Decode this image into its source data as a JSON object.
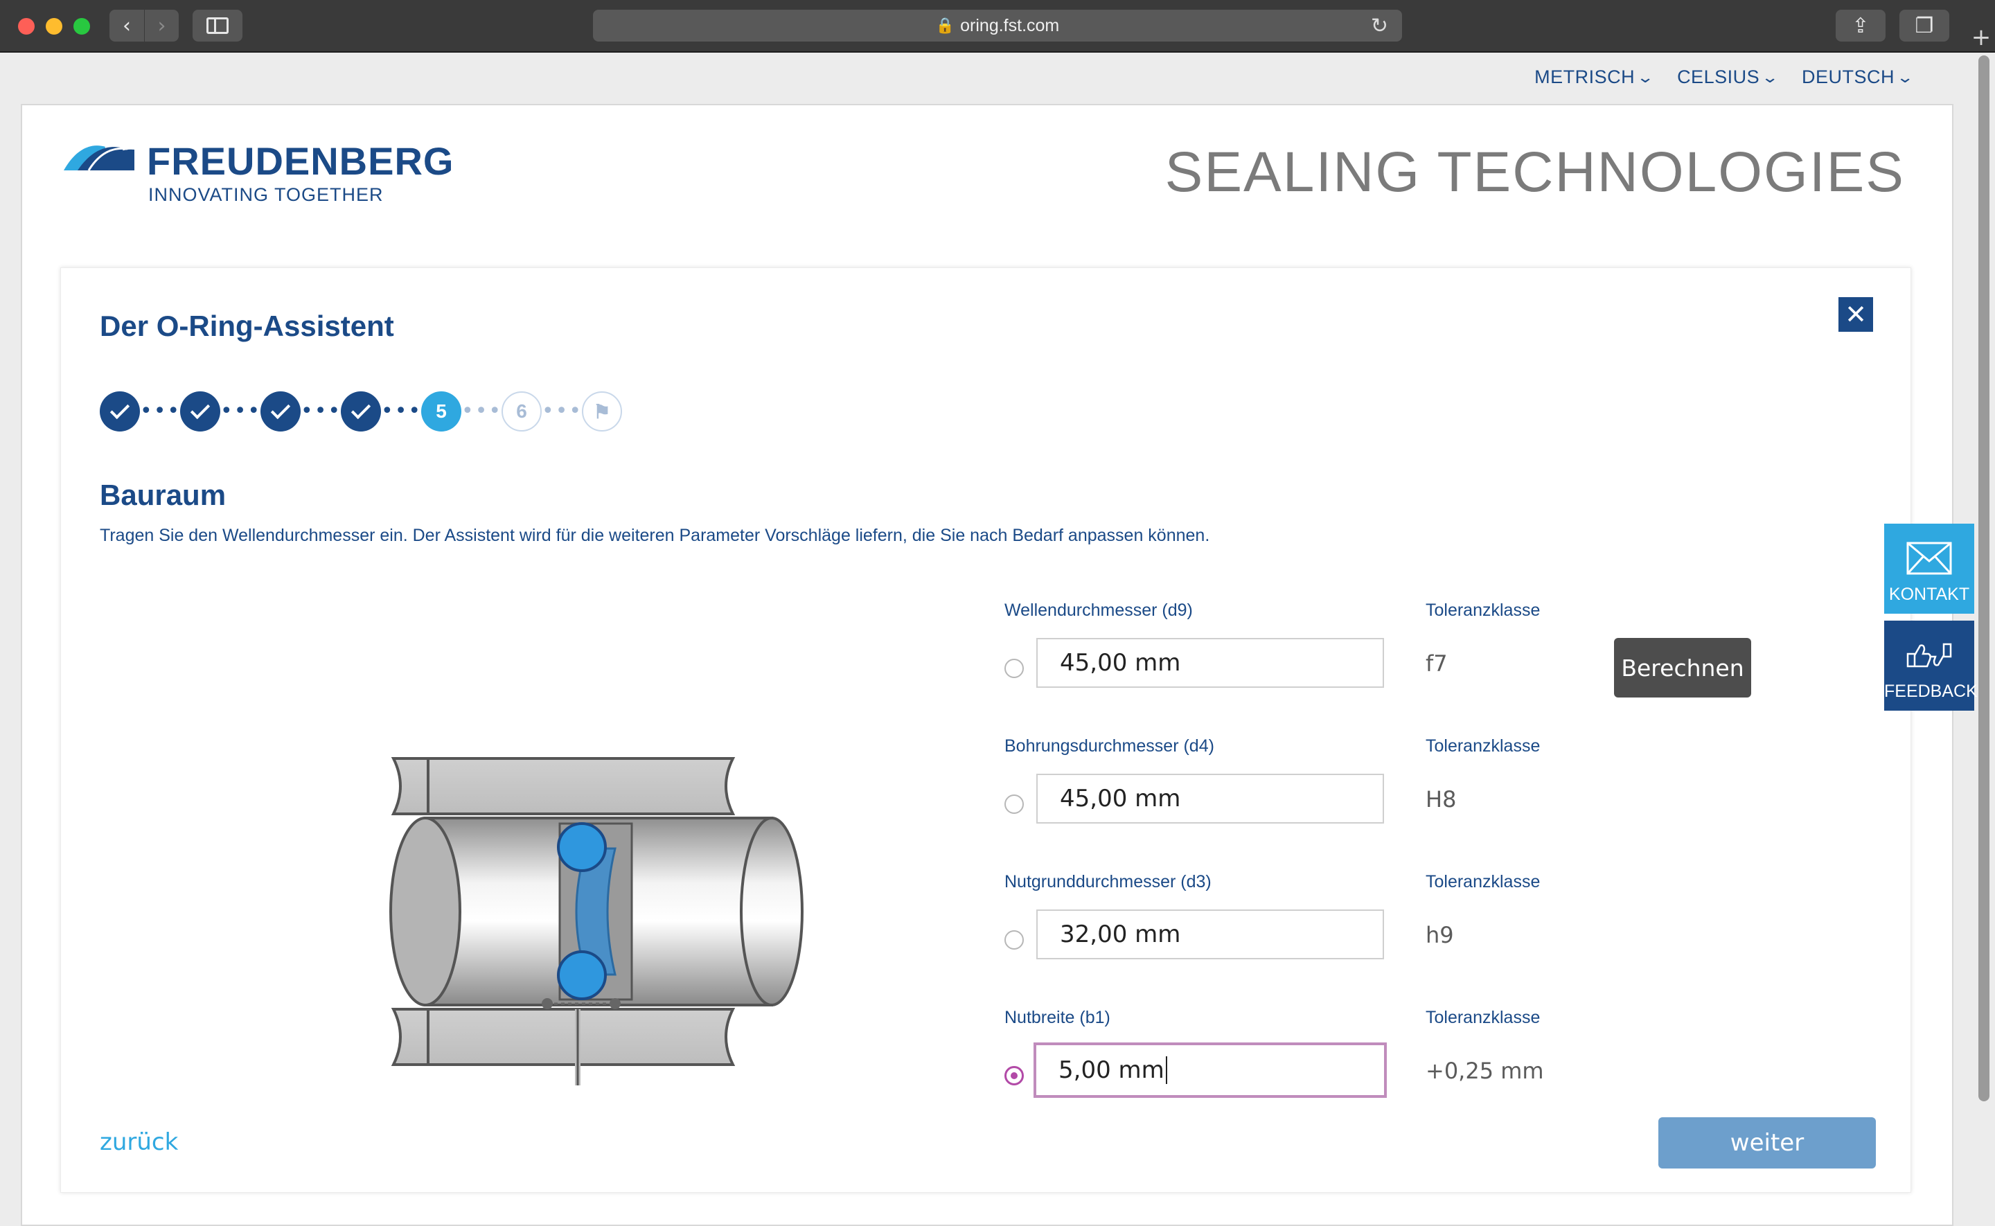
{
  "browser": {
    "url": "oring.fst.com",
    "lock_glyph": "🔒",
    "back_glyph": "‹",
    "forward_glyph": "›",
    "reload_glyph": "↻",
    "share_glyph": "⇪",
    "tabs_glyph": "❐",
    "newtab_glyph": "+"
  },
  "units": {
    "measurement": "METRISCH",
    "temperature": "CELSIUS",
    "language": "DEUTSCH",
    "chevron_glyph": "⌄"
  },
  "brand": {
    "name": "FREUDENBERG",
    "tagline": "INNOVATING TOGETHER",
    "division": "SEALING TECHNOLOGIES",
    "wave_color_light": "#2fa8e0",
    "wave_color_dark": "#1b4a87"
  },
  "assistant": {
    "title": "Der O-Ring-Assistent",
    "close_glyph": "✕",
    "steps": [
      {
        "label": "",
        "status": "done"
      },
      {
        "label": "",
        "status": "done"
      },
      {
        "label": "",
        "status": "done"
      },
      {
        "label": "",
        "status": "done"
      },
      {
        "label": "5",
        "status": "active"
      },
      {
        "label": "6",
        "status": "todo"
      },
      {
        "label": "⚑",
        "status": "todo"
      }
    ],
    "dots_glyph": "•••",
    "section_title": "Bauraum",
    "section_description": "Tragen Sie den Wellendurchmesser ein. Der Assistent wird für die weiteren Parameter Vorschläge liefern, die Sie nach Bedarf anpassen können.",
    "tolerance_header": "Toleranzklasse",
    "fields": [
      {
        "label": "Wellendurchmesser (d9)",
        "value": "45,00 mm",
        "tolerance": "f7",
        "selected": false
      },
      {
        "label": "Bohrungsdurchmesser (d4)",
        "value": "45,00 mm",
        "tolerance": "H8",
        "selected": false
      },
      {
        "label": "Nutgrunddurchmesser (d3)",
        "value": "32,00 mm",
        "tolerance": "h9",
        "selected": false
      },
      {
        "label": "Nutbreite (b1)",
        "value": "5,00 mm",
        "tolerance": "+0,25 mm",
        "selected": true
      }
    ],
    "calculate_label": "Berechnen",
    "back_label": "zurück",
    "next_label": "weiter"
  },
  "side_tabs": {
    "contact": "KONTAKT",
    "feedback": "FEEDBACK"
  },
  "colors": {
    "primary": "#1b4a87",
    "accent": "#2fa8e0",
    "focus": "#b24aa7"
  }
}
